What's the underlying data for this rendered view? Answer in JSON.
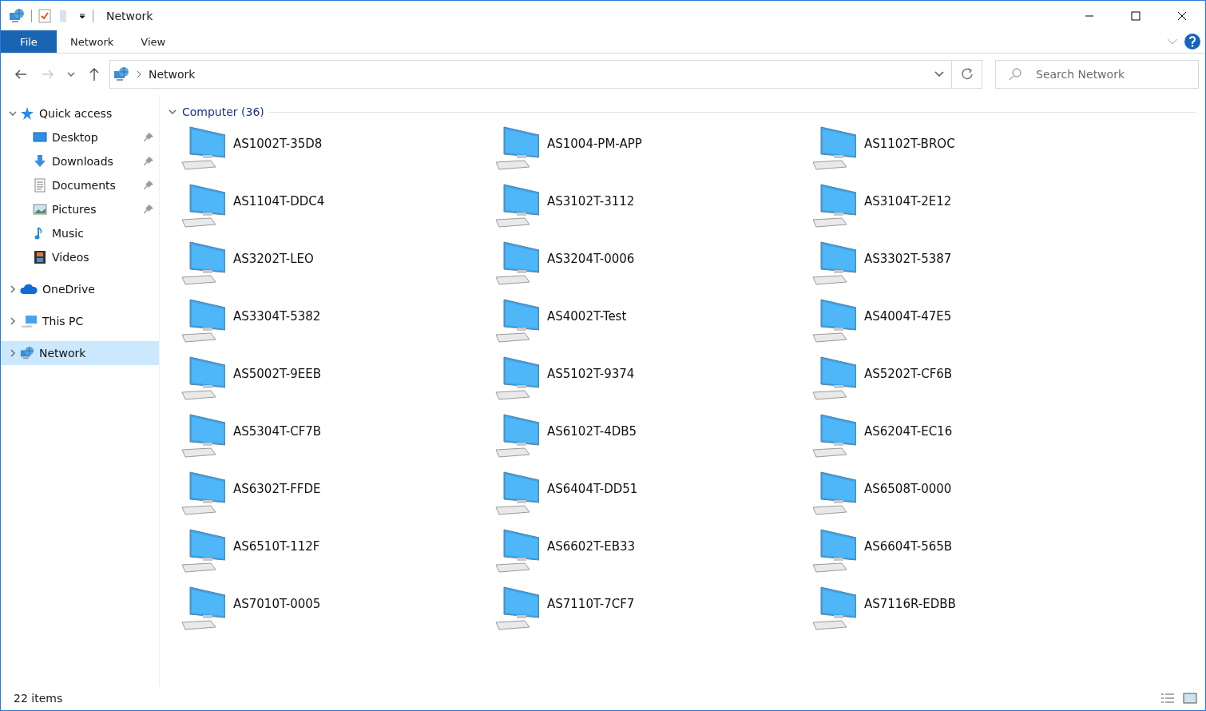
{
  "window": {
    "title": "Network"
  },
  "ribbon_tabs": [
    {
      "label": "File",
      "kind": "file"
    },
    {
      "label": "Network",
      "kind": "tab"
    },
    {
      "label": "View",
      "kind": "tab"
    }
  ],
  "address_bar": {
    "location": "Network"
  },
  "search": {
    "placeholder": "Search Network"
  },
  "sidebar": {
    "items": [
      {
        "label": "Quick access",
        "kind": "star",
        "expanded": true,
        "selected": false,
        "children": [
          {
            "label": "Desktop",
            "kind": "desktop",
            "pinned": true,
            "selected": false
          },
          {
            "label": "Downloads",
            "kind": "download",
            "pinned": true,
            "selected": false
          },
          {
            "label": "Documents",
            "kind": "document",
            "pinned": true,
            "selected": false
          },
          {
            "label": "Pictures",
            "kind": "picture",
            "pinned": true,
            "selected": false
          },
          {
            "label": "Music",
            "kind": "music",
            "pinned": false,
            "selected": false
          },
          {
            "label": "Videos",
            "kind": "video",
            "pinned": false,
            "selected": false
          }
        ]
      },
      {
        "label": "OneDrive",
        "kind": "cloud",
        "expanded": false,
        "selected": false
      },
      {
        "label": "This PC",
        "kind": "pc",
        "expanded": false,
        "selected": false
      },
      {
        "label": "Network",
        "kind": "network",
        "expanded": false,
        "selected": true
      }
    ]
  },
  "group": {
    "title": "Computer (36)",
    "expanded": true,
    "items": [
      "AS1002T-35D8",
      "AS1004-PM-APP",
      "AS1102T-BROC",
      "AS1104T-DDC4",
      "AS3102T-3112",
      "AS3104T-2E12",
      "AS3202T-LEO",
      "AS3204T-0006",
      "AS3302T-5387",
      "AS3304T-5382",
      "AS4002T-Test",
      "AS4004T-47E5",
      "AS5002T-9EEB",
      "AS5102T-9374",
      "AS5202T-CF6B",
      "AS5304T-CF7B",
      "AS6102T-4DB5",
      "AS6204T-EC16",
      "AS6302T-FFDE",
      "AS6404T-DD51",
      "AS6508T-0000",
      "AS6510T-112F",
      "AS6602T-EB33",
      "AS6604T-565B",
      "AS7010T-0005",
      "AS7110T-7CF7",
      "AS7116R-EDBB"
    ]
  },
  "status_bar": {
    "count": "22 items"
  }
}
